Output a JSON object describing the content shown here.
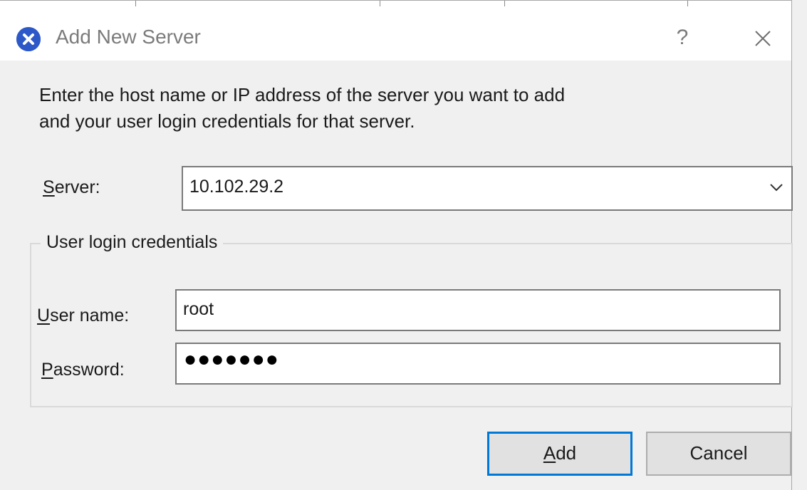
{
  "window": {
    "title": "Add New Server",
    "help_label": "?",
    "close_icon": "close-icon",
    "app_icon": "xencenter-x-icon"
  },
  "instructions": {
    "line1": "Enter the host name or IP address of the server you want to add",
    "line2": "and your user login credentials for that server."
  },
  "server": {
    "label_mnemonic": "S",
    "label_rest": "erver:",
    "value": "10.102.29.2",
    "dropdown_icon": "chevron-down-icon"
  },
  "credentials": {
    "group_label": "User login credentials",
    "username_label_mnemonic": "U",
    "username_label_rest": "ser name:",
    "username_value": "root",
    "password_label_mnemonic": "P",
    "password_label_rest": "assword:",
    "password_mask": "●●●●●●●"
  },
  "buttons": {
    "add_mnemonic": "A",
    "add_rest": "dd",
    "cancel": "Cancel"
  },
  "colors": {
    "accent": "#0078d7",
    "icon_blue": "#2d59c8"
  }
}
